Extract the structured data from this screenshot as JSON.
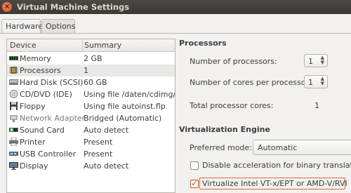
{
  "window": {
    "title": "Virtual Machine Settings"
  },
  "tabs": [
    {
      "label": "Hardware"
    },
    {
      "label": "Options"
    }
  ],
  "device_table": {
    "headers": {
      "device": "Device",
      "summary": "Summary"
    },
    "rows": [
      {
        "device": "Memory",
        "summary": "2 GB",
        "icon": "memory-icon"
      },
      {
        "device": "Processors",
        "summary": "1",
        "icon": "processor-icon"
      },
      {
        "device": "Hard Disk (SCSI)",
        "summary": "60 GB",
        "icon": "hard-disk-icon"
      },
      {
        "device": "CD/DVD (IDE)",
        "summary": "Using file /daten/cdimg/m",
        "icon": "cd-dvd-icon"
      },
      {
        "device": "Floppy",
        "summary": "Using file autoinst.flp",
        "icon": "floppy-icon"
      },
      {
        "device": "Network Adapter",
        "summary": "Bridged (Automatic)",
        "icon": "network-adapter-icon"
      },
      {
        "device": "Sound Card",
        "summary": "Auto detect",
        "icon": "sound-card-icon"
      },
      {
        "device": "Printer",
        "summary": "Present",
        "icon": "printer-icon"
      },
      {
        "device": "USB Controller",
        "summary": "Present",
        "icon": "usb-icon"
      },
      {
        "device": "Display",
        "summary": "Auto detect",
        "icon": "display-icon"
      }
    ]
  },
  "processors": {
    "section_title": "Processors",
    "num_processors_label": "Number of processors:",
    "num_processors_value": "1",
    "cores_label": "Number of cores per processor:",
    "cores_value": "1",
    "total_label": "Total processor cores:",
    "total_value": "1"
  },
  "virtualization": {
    "section_title": "Virtualization Engine",
    "preferred_mode_label": "Preferred mode:",
    "preferred_mode_value": "Automatic",
    "disable_accel_label": "Disable acceleration for binary translation",
    "disable_accel_checked": false,
    "vtx_label": "Virtualize Intel VT-x/EPT or AMD-V/RVI",
    "vtx_checked": true
  },
  "colors": {
    "accent": "#e06a2e",
    "titlebar": "#3c3b37"
  }
}
